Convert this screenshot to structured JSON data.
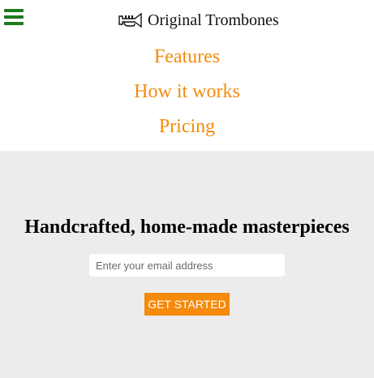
{
  "colors": {
    "hamburger": "#1f7a1f",
    "accent": "#f58a0b",
    "hero_background": "#ececec",
    "button_text": "#ffffff",
    "title_text": "#000000"
  },
  "header": {
    "menu_icon": "hamburger-menu-icon",
    "logo_icon": "trumpet-logo-icon",
    "brand_name": "Original Trombones"
  },
  "nav": {
    "items": [
      {
        "label": "Features"
      },
      {
        "label": "How it works"
      },
      {
        "label": "Pricing"
      }
    ]
  },
  "hero": {
    "title": "Handcrafted, home-made masterpieces",
    "email_placeholder": "Enter your email address",
    "email_value": "",
    "cta_label": "GET STARTED"
  }
}
